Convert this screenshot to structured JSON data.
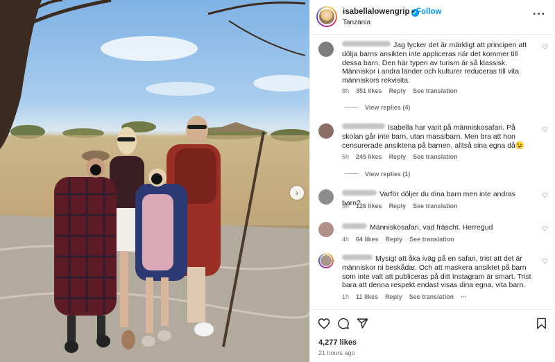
{
  "header": {
    "username": "isabellalowengrip",
    "verified_glyph": "✓",
    "dot": "•",
    "follow_label": "Follow",
    "location": "Tanzania",
    "more_glyph": "···"
  },
  "photo": {
    "next_glyph": "›"
  },
  "comments": [
    {
      "text": "Jag tycker det är märkligt att principen att dölja barns ansikten inte appliceras när det kommer till dessa barn. Den här typen av turism är så klassisk. Människor i andra länder och kulturer reduceras till vita människors rekvisita.",
      "time": "8h",
      "likes": "351 likes",
      "reply": "Reply",
      "translate": "See translation",
      "view_replies": "View replies (4)"
    },
    {
      "text": "Isabella har varit på människosafari. På skolan går inte barn, utan masaibarn. Men bra att hon censurerade ansiktena på barnen, alltså sina egna då😉",
      "time": "5h",
      "likes": "245 likes",
      "reply": "Reply",
      "translate": "See translation",
      "view_replies": "View replies (1)"
    },
    {
      "text": "Varför döljer du dina barn men inte andras barn?",
      "time": "5h",
      "likes": "126 likes",
      "reply": "Reply",
      "translate": "See translation"
    },
    {
      "text": "Människosafari, vad fräscht. Herregud",
      "time": "4h",
      "likes": "64 likes",
      "reply": "Reply",
      "translate": "See translation"
    },
    {
      "text": "Mysigt att åka iväg på en safari, trist att det är människor ni beskådar. Och att maskera ansiktet på barn som inte valt att publiceras på ditt Instagram är smart. Trist bara att denna respekt endast visas dina egna, vita barn.",
      "time": "1h",
      "likes": "11 likes",
      "reply": "Reply",
      "translate": "See translation",
      "more": "···"
    }
  ],
  "footer": {
    "likes": "4,277 likes",
    "time": "21 hours ago"
  },
  "colors": {
    "accent": "#0095f6",
    "text": "#262626",
    "secondary": "#737373"
  }
}
